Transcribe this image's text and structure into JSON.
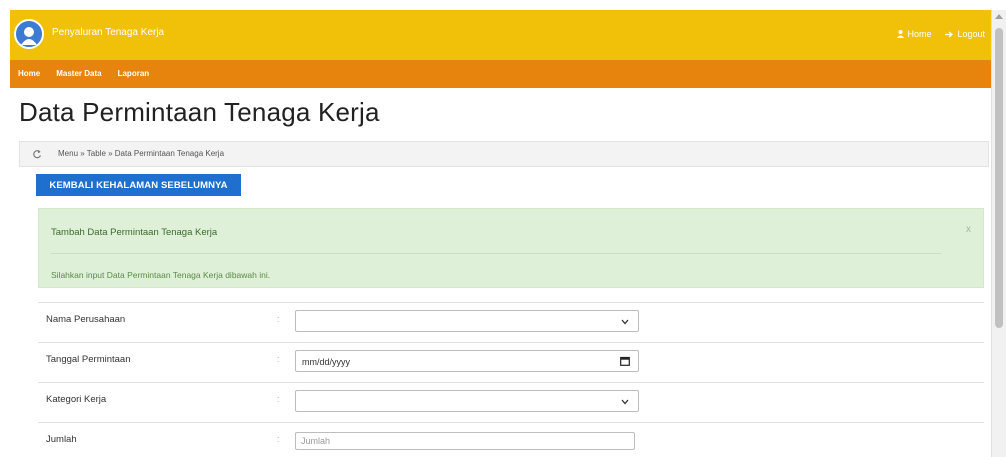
{
  "header": {
    "app_title": "Penyaluran Tenaga Kerja",
    "home_link": "Home",
    "logout_link": "Logout"
  },
  "nav": {
    "items": [
      {
        "label": "Home"
      },
      {
        "label": "Master Data"
      },
      {
        "label": "Laporan"
      }
    ]
  },
  "page": {
    "title": "Data Permintaan Tenaga Kerja",
    "breadcrumb": "Menu » Table » Data Permintaan Tenaga Kerja",
    "back_button": "KEMBALI KEHALAMAN SEBELUMNYA"
  },
  "alert": {
    "title": "Tambah Data Permintaan Tenaga Kerja",
    "message": "Silahkan input Data Permintaan Tenaga Kerja dibawah ini.",
    "close": "x"
  },
  "form": {
    "colon": ":",
    "fields": [
      {
        "label": "Nama Perusahaan",
        "type": "select",
        "value": ""
      },
      {
        "label": "Tanggal Permintaan",
        "type": "date",
        "value": "mm/dd/yyyy"
      },
      {
        "label": "Kategori Kerja",
        "type": "select",
        "value": ""
      },
      {
        "label": "Jumlah",
        "type": "text",
        "value": "",
        "placeholder": "Jumlah"
      }
    ]
  },
  "colors": {
    "topbar": "#f1c10a",
    "navbar": "#e7840d",
    "button": "#1e6fce",
    "alert_bg": "#dff0d8"
  },
  "icons": [
    "logo-icon",
    "user-icon",
    "logout-icon",
    "refresh-icon",
    "chevron-down-icon",
    "calendar-icon",
    "close-icon"
  ]
}
